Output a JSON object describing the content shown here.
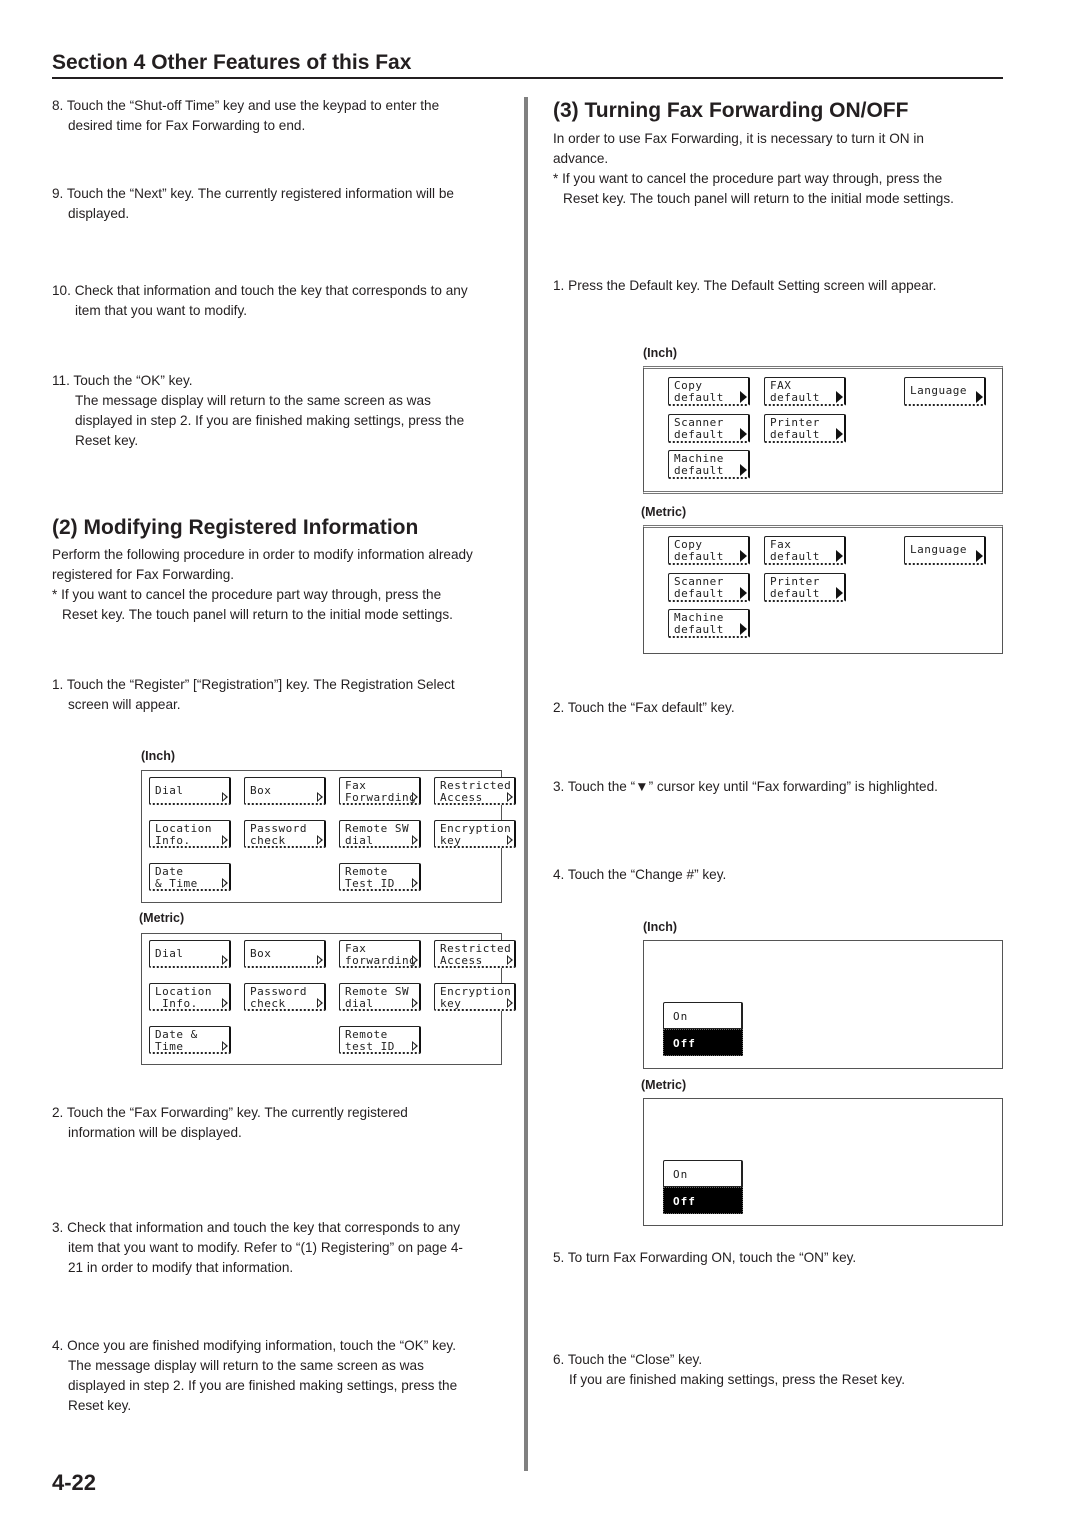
{
  "header": {
    "title": "Section 4 Other Features of this Fax"
  },
  "left": {
    "steps_top": [
      {
        "num": "8.",
        "lines": [
          "Touch the “Shut-off Time” key and use the keypad to enter the",
          "desired time for Fax Forwarding to end."
        ]
      },
      {
        "num": "9.",
        "lines": [
          "Touch the “Next” key. The currently registered information will be",
          "displayed."
        ]
      },
      {
        "num": "10.",
        "lines": [
          "Check that information and touch the key that corresponds to any",
          "item that you want to modify."
        ]
      },
      {
        "num": "11.",
        "lines": [
          "Touch the “OK” key.",
          "The message display will return to the same screen as was",
          "displayed in step 2. If you are finished making settings, press the",
          "Reset key."
        ]
      }
    ],
    "section2": {
      "title": "(2) Modifying Registered Information",
      "intro": [
        "Perform the following procedure in order to modify information already",
        "registered for Fax Forwarding."
      ],
      "note": [
        "* If you want to cancel the procedure part way through, press the",
        "Reset key. The touch panel will return to the initial mode settings."
      ],
      "steps": [
        {
          "num": "1.",
          "lines": [
            "Touch the “Register” [“Registration”] key. The Registration Select",
            "screen will appear."
          ]
        },
        {
          "num": "2.",
          "lines": [
            "Touch the “Fax Forwarding” key. The currently registered",
            "information will be displayed."
          ]
        },
        {
          "num": "3.",
          "lines": [
            "Check that information and touch the key that corresponds to any",
            "item that you want to modify. Refer to “(1) Registering” on page 4-",
            "21 in order to modify that information."
          ]
        },
        {
          "num": "4.",
          "lines": [
            "Once you are finished modifying information, touch the “OK” key.",
            "The message display will return to the same screen as was",
            "displayed in step 2. If you are finished making settings, press the",
            "Reset key."
          ]
        }
      ],
      "inch_caption": "(Inch)",
      "metric_caption": "(Metric)",
      "registration_inch_keys": [
        "Dial",
        "Box",
        "Fax\nForwarding",
        "Restricted\nAccess",
        "Location\nInfo.",
        "Password\ncheck",
        "Remote SW\ndial",
        "Encryption\nkey",
        "Date\n& Time",
        "",
        "Remote\nTest ID",
        ""
      ],
      "registration_metric_keys": [
        "Dial",
        "Box",
        "Fax\nforwarding",
        "Restricted\nAccess",
        "Location\n Info.",
        "Password\ncheck",
        "Remote SW\ndial",
        "Encryption\nkey",
        "Date &\nTime",
        "",
        "Remote\ntest ID",
        ""
      ]
    }
  },
  "right": {
    "section3": {
      "title": "(3) Turning Fax Forwarding ON/OFF",
      "intro": [
        "In order to use Fax Forwarding, it is necessary to turn it ON in",
        "advance."
      ],
      "note": [
        "* If you want to cancel the procedure part way through, press the",
        "Reset key. The touch panel will return to the initial mode settings."
      ],
      "steps": [
        {
          "num": "1.",
          "lines": [
            "Press the Default key. The Default Setting screen will appear."
          ]
        },
        {
          "num": "2.",
          "lines": [
            "Touch the “Fax default” key."
          ]
        },
        {
          "num": "3.",
          "lines": [
            "Touch the “▼” cursor key until “Fax forwarding” is highlighted."
          ]
        },
        {
          "num": "4.",
          "lines": [
            "Touch the “Change #” key."
          ]
        },
        {
          "num": "5.",
          "lines": [
            "To turn Fax Forwarding ON, touch the “ON” key."
          ]
        },
        {
          "num": "6.",
          "lines": [
            "Touch the “Close” key.",
            "If you are finished making settings, press the Reset key."
          ]
        }
      ],
      "inch_caption": "(Inch)",
      "metric_caption": "(Metric)",
      "default_inch_keys": [
        "Copy\ndefault",
        "FAX\ndefault",
        "Language",
        "Scanner\ndefault",
        "Printer\ndefault",
        "Machine\ndefault"
      ],
      "default_metric_keys": [
        "Copy\ndefault",
        "Fax\ndefault",
        "Language",
        "Scanner\ndefault",
        "Printer\ndefault",
        "Machine\ndefault"
      ],
      "toggle_inch": {
        "on": "On",
        "off": "Off",
        "selected": "Off"
      },
      "toggle_metric": {
        "on": "On",
        "off": "Off",
        "selected": "Off"
      }
    }
  },
  "footer": {
    "page_number": "4-22"
  }
}
